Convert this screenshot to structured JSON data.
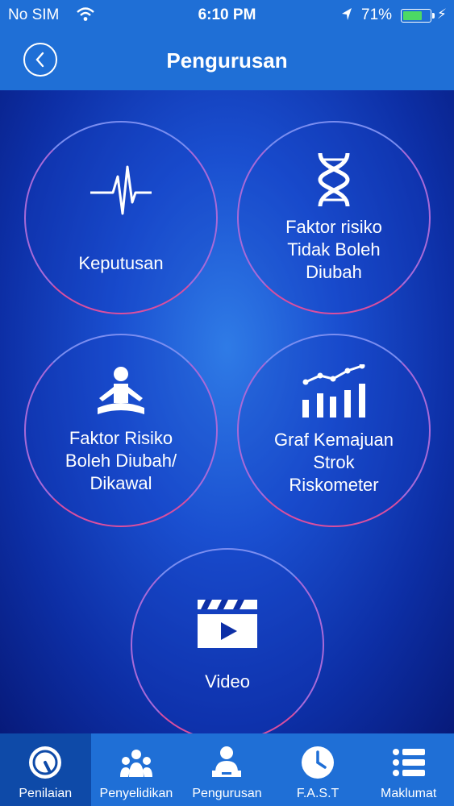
{
  "status_bar": {
    "carrier": "No SIM",
    "time": "6:10 PM",
    "battery_percent": "71%",
    "battery_level": 0.71,
    "battery_color": "#4cd964"
  },
  "nav": {
    "title": "Pengurusan",
    "back_icon": "chevron-left-icon"
  },
  "tiles": [
    {
      "label": "Keputusan",
      "icon": "heartbeat-icon"
    },
    {
      "label": "Faktor risiko\nTidak Boleh\nDiubah",
      "icon": "dna-icon"
    },
    {
      "label": "Faktor Risiko\nBoleh Diubah/\nDikawal",
      "icon": "meditation-icon"
    },
    {
      "label": "Graf Kemajuan\nStrok\nRiskometer",
      "icon": "bar-chart-trend-icon"
    },
    {
      "label": "Video",
      "icon": "video-clapper-icon"
    }
  ],
  "tab_bar": {
    "active_index": 0,
    "tabs": [
      {
        "label": "Penilaian",
        "icon": "gauge-icon"
      },
      {
        "label": "Penyelidikan",
        "icon": "people-group-icon"
      },
      {
        "label": "Pengurusan",
        "icon": "person-laptop-icon"
      },
      {
        "label": "F.A.S.T",
        "icon": "clock-icon"
      },
      {
        "label": "Maklumat",
        "icon": "list-icon"
      }
    ]
  },
  "colors": {
    "bar_blue": "#1f6fd6",
    "active_tab": "#0e4aa8",
    "background_deep": "#071a7a"
  }
}
